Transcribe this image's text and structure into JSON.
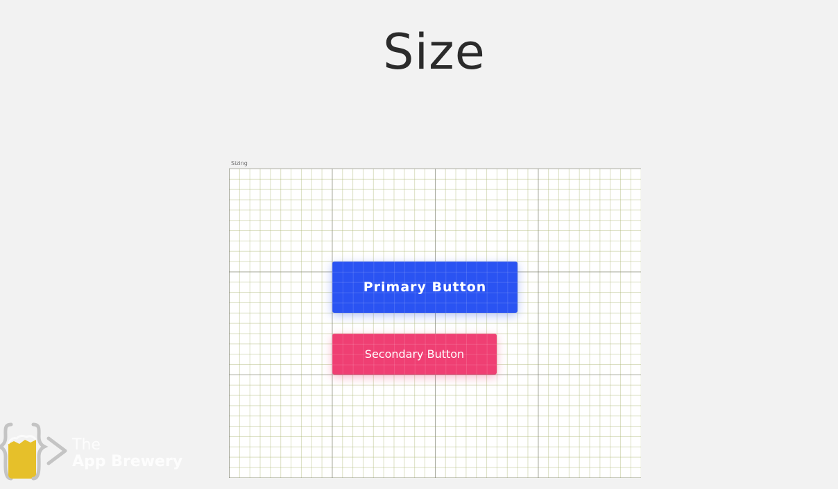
{
  "slide": {
    "title": "Size"
  },
  "frame": {
    "label": "Sizing"
  },
  "buttons": {
    "primary_label": "Primary Button",
    "secondary_label": "Secondary Button"
  },
  "watermark": {
    "line1": "The",
    "line2": "App Brewery",
    "logo_icon": "beer-mug-braces-icon"
  },
  "colors": {
    "background": "#f2f2f2",
    "primary": "#2a53f2",
    "secondary": "#ef3f73",
    "logo_yellow": "#e6c02a",
    "logo_gray": "#bdbdbd"
  }
}
